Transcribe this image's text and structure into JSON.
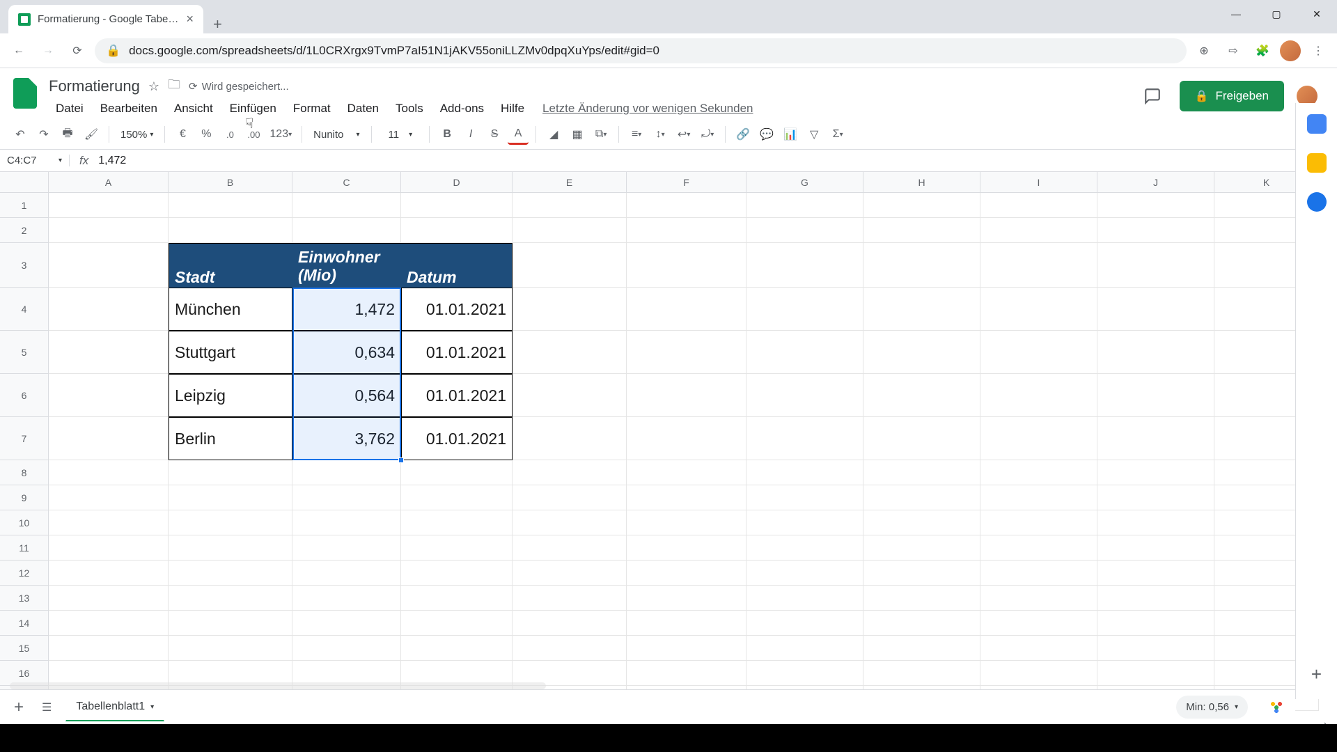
{
  "browser": {
    "tab_title": "Formatierung - Google Tabellen",
    "url": "docs.google.com/spreadsheets/d/1L0CRXrgx9TvmP7aI51N1jAKV55oniLLZMv0dpqXuYps/edit#gid=0"
  },
  "doc": {
    "title": "Formatierung",
    "save_status": "Wird gespeichert...",
    "last_edit": "Letzte Änderung vor wenigen Sekunden"
  },
  "menu": {
    "file": "Datei",
    "edit": "Bearbeiten",
    "view": "Ansicht",
    "insert": "Einfügen",
    "format": "Format",
    "data": "Daten",
    "tools": "Tools",
    "addons": "Add-ons",
    "help": "Hilfe"
  },
  "toolbar": {
    "zoom": "150%",
    "currency": "€",
    "percent": "%",
    "dec_less": ".0",
    "dec_more": ".00",
    "num_format": "123",
    "font": "Nunito",
    "font_size": "11"
  },
  "share": {
    "label": "Freigeben"
  },
  "namebox": "C4:C7",
  "formula_value": "1,472",
  "columns": [
    "A",
    "B",
    "C",
    "D",
    "E",
    "F",
    "G",
    "H",
    "I",
    "J",
    "K"
  ],
  "table": {
    "headers": {
      "city": "Stadt",
      "pop": "Einwohner (Mio)",
      "date": "Datum"
    },
    "rows": [
      {
        "city": "München",
        "pop": "1,472",
        "date": "01.01.2021"
      },
      {
        "city": "Stuttgart",
        "pop": "0,634",
        "date": "01.01.2021"
      },
      {
        "city": "Leipzig",
        "pop": "0,564",
        "date": "01.01.2021"
      },
      {
        "city": "Berlin",
        "pop": "3,762",
        "date": "01.01.2021"
      }
    ]
  },
  "sheet_tab": "Tabellenblatt1",
  "explore": {
    "label": "Min: 0,56"
  }
}
